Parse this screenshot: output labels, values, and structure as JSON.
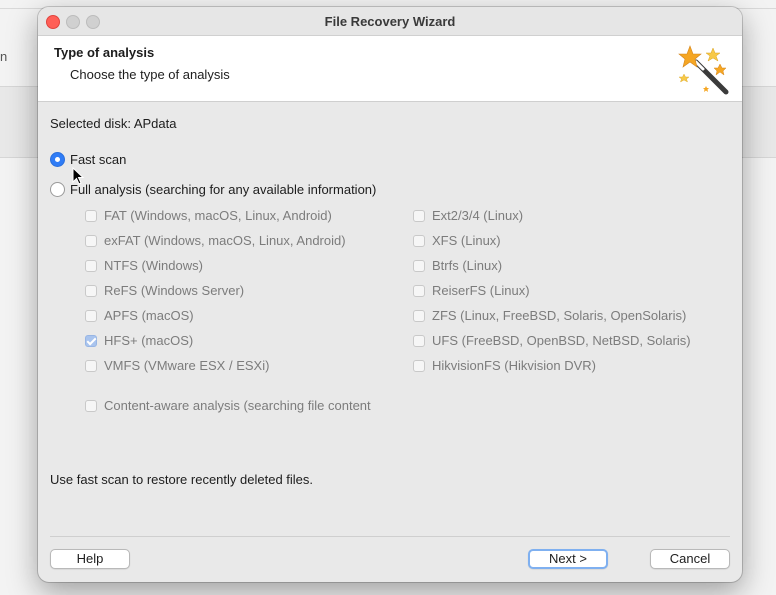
{
  "background": {
    "fragment": "n"
  },
  "window": {
    "title": "File Recovery Wizard"
  },
  "header": {
    "title": "Type of analysis",
    "subtitle": "Choose the type of analysis",
    "icon": "magic-wand-icon"
  },
  "selected_disk": "Selected disk: APdata",
  "scan_options": [
    {
      "label": "Fast scan",
      "selected": true
    },
    {
      "label": "Full analysis (searching for any available information)",
      "selected": false
    }
  ],
  "filesystems_left": [
    {
      "label": "FAT (Windows, macOS, Linux, Android)",
      "checked": false
    },
    {
      "label": "exFAT (Windows, macOS, Linux, Android)",
      "checked": false
    },
    {
      "label": "NTFS (Windows)",
      "checked": false
    },
    {
      "label": "ReFS (Windows Server)",
      "checked": false
    },
    {
      "label": "APFS (macOS)",
      "checked": false
    },
    {
      "label": "HFS+ (macOS)",
      "checked": true
    },
    {
      "label": "VMFS (VMware ESX / ESXi)",
      "checked": false
    }
  ],
  "filesystems_right": [
    {
      "label": "Ext2/3/4 (Linux)",
      "checked": false
    },
    {
      "label": "XFS (Linux)",
      "checked": false
    },
    {
      "label": "Btrfs (Linux)",
      "checked": false
    },
    {
      "label": "ReiserFS (Linux)",
      "checked": false
    },
    {
      "label": "ZFS (Linux, FreeBSD, Solaris, OpenSolaris)",
      "checked": false
    },
    {
      "label": "UFS (FreeBSD, OpenBSD, NetBSD, Solaris)",
      "checked": false
    },
    {
      "label": "HikvisionFS (Hikvision DVR)",
      "checked": false
    }
  ],
  "content_aware": {
    "label": "Content-aware analysis (searching file content",
    "checked": false
  },
  "hint": "Use fast scan to restore recently deleted files.",
  "buttons": {
    "help": "Help",
    "next": "Next >",
    "cancel": "Cancel"
  },
  "colors": {
    "accent": "#2f7cf6",
    "close": "#ff5f57"
  }
}
